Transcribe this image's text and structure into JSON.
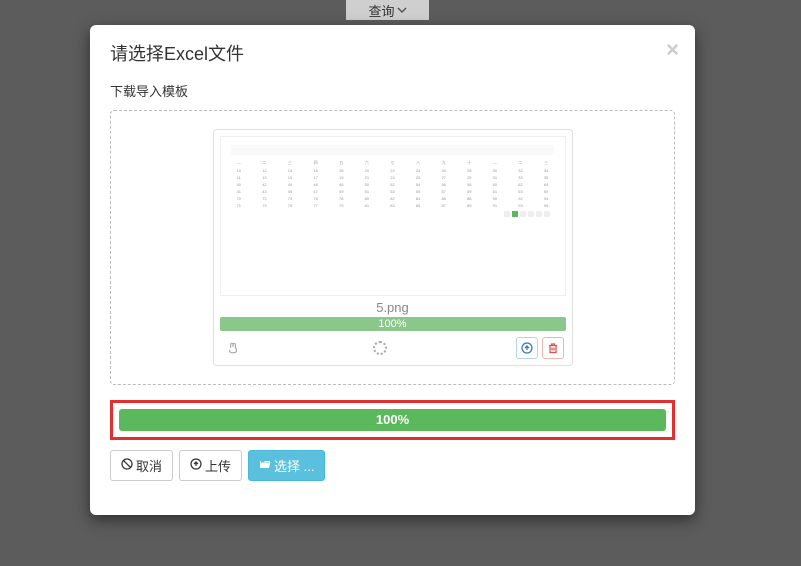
{
  "background": {
    "query_button": "查询"
  },
  "modal": {
    "title": "请选择Excel文件",
    "download_template": "下载导入模板",
    "file": {
      "name": "5.png",
      "progress_text": "100%"
    },
    "main_progress_text": "100%",
    "buttons": {
      "cancel": "取消",
      "upload": "上传",
      "select": "选择 ..."
    }
  },
  "colors": {
    "success": "#5cb85c",
    "highlight_border": "#e03030",
    "info": "#5bc0de"
  }
}
